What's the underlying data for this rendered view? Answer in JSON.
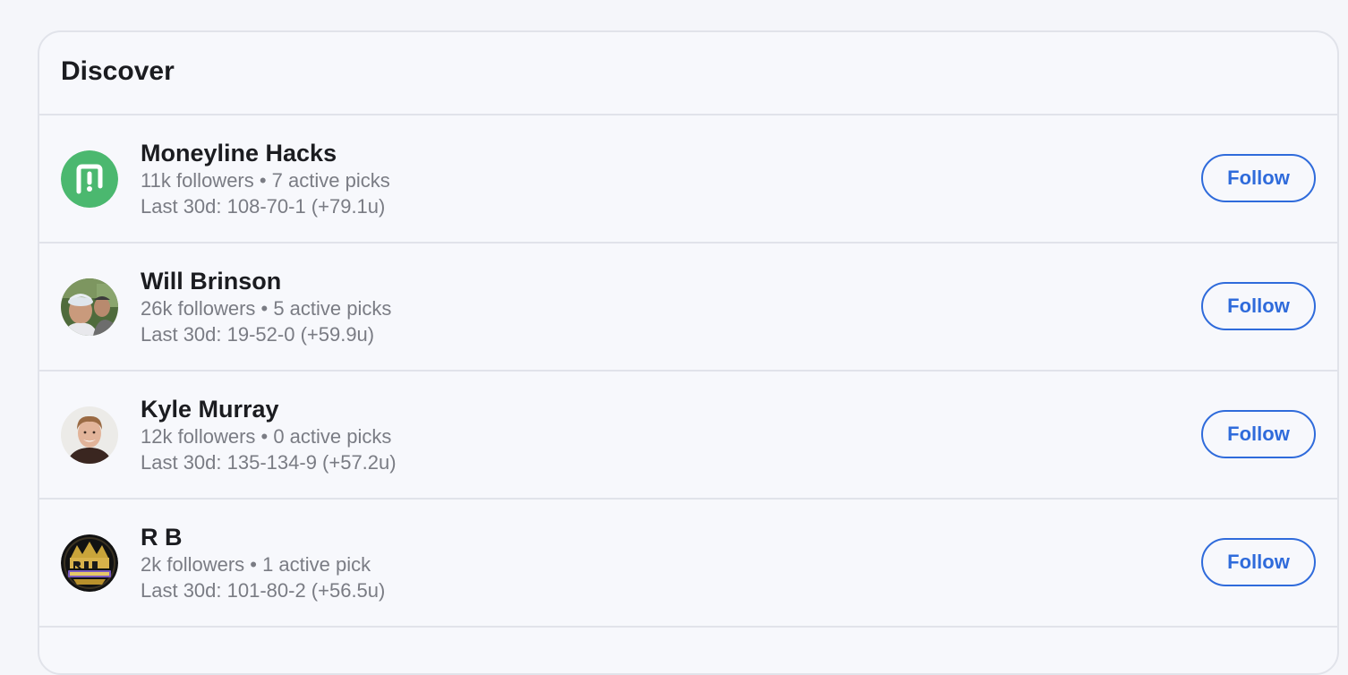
{
  "discover": {
    "title": "Discover",
    "follow_label": "Follow",
    "accounts": [
      {
        "name": "Moneyline Hacks",
        "stats": "11k followers • 7 active picks",
        "record": "Last 30d: 108-70-1 (+79.1u)",
        "avatar_icon": "moneyline-hacks-logo-icon",
        "avatar_color": "#4bb86f"
      },
      {
        "name": "Will Brinson",
        "stats": "26k followers • 5 active picks",
        "record": "Last 30d: 19-52-0 (+59.9u)",
        "avatar_icon": "user-photo-avatar"
      },
      {
        "name": "Kyle Murray",
        "stats": "12k followers • 0 active picks",
        "record": "Last 30d: 135-134-9 (+57.2u)",
        "avatar_icon": "user-photo-avatar"
      },
      {
        "name": "R B",
        "stats": "2k followers • 1 active pick",
        "record": "Last 30d: 101-80-2 (+56.5u)",
        "avatar_icon": "rbs-sports-plays-logo-icon"
      }
    ]
  }
}
